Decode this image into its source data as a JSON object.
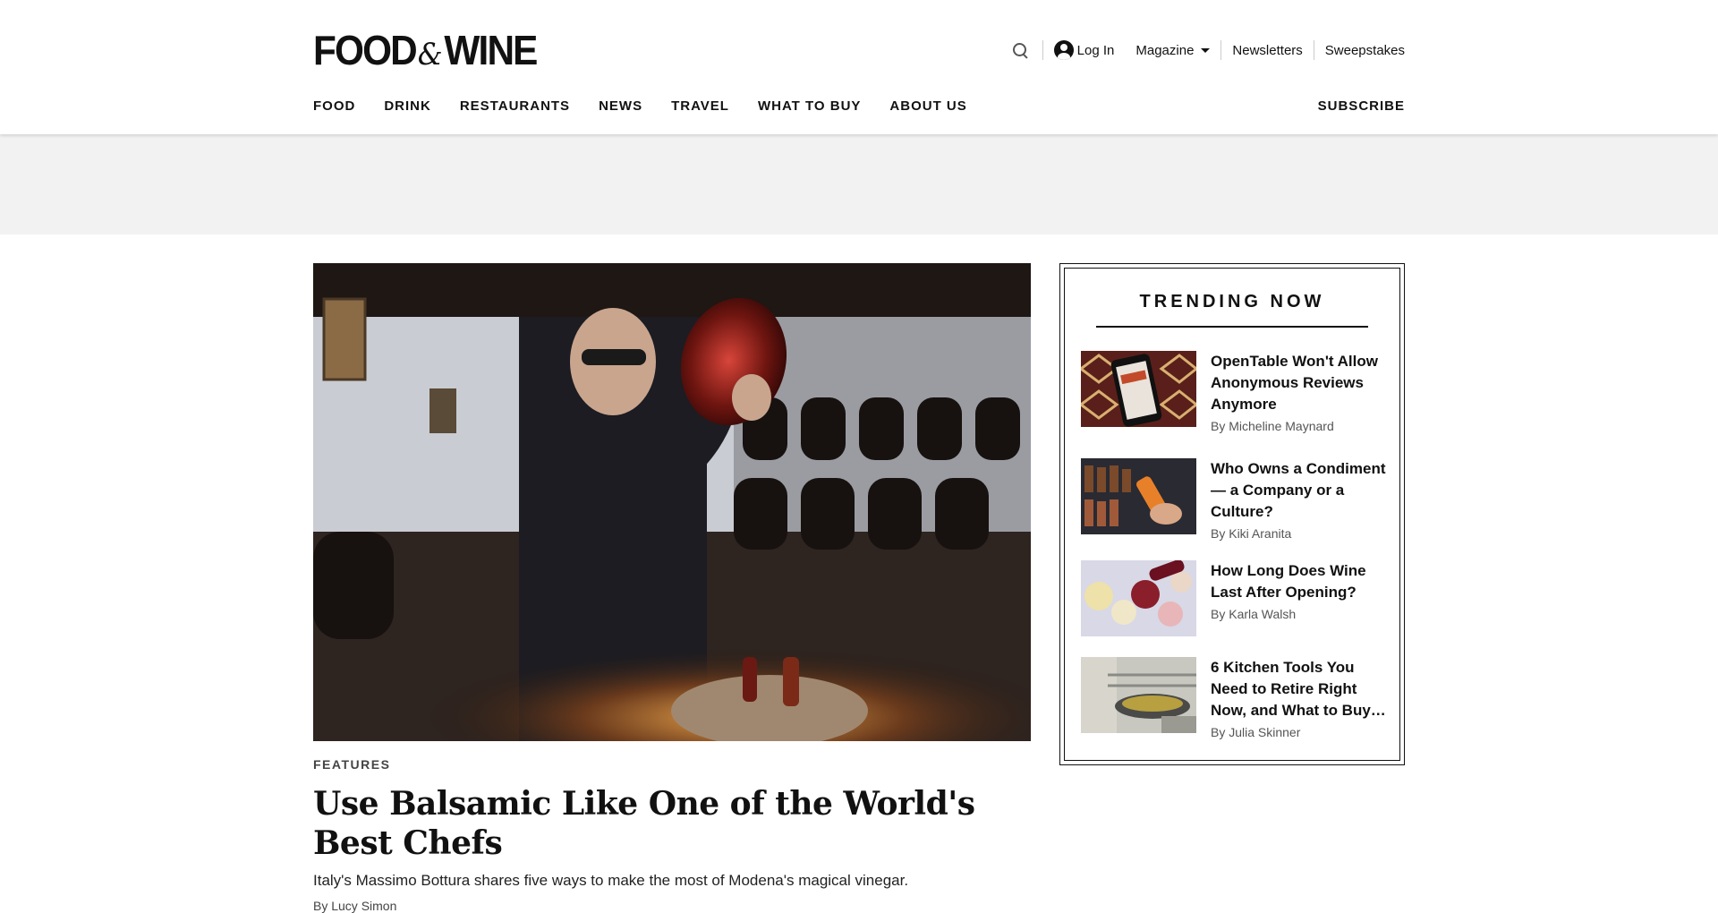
{
  "brand": {
    "logo_left": "FOOD",
    "logo_amp": "&",
    "logo_right": "WINE"
  },
  "utility": {
    "login": "Log In",
    "magazine": "Magazine",
    "newsletters": "Newsletters",
    "sweepstakes": "Sweepstakes"
  },
  "nav": {
    "items": [
      "FOOD",
      "DRINK",
      "RESTAURANTS",
      "NEWS",
      "TRAVEL",
      "WHAT TO BUY",
      "ABOUT US"
    ],
    "subscribe": "SUBSCRIBE"
  },
  "hero": {
    "kicker": "FEATURES",
    "headline": "Use Balsamic Like One of the World's Best Chefs",
    "dek": "Italy's Massimo Bottura shares five ways to make the most of Modena's magical vinegar.",
    "byline": "By Lucy Simon"
  },
  "trending": {
    "title": "TRENDING NOW",
    "items": [
      {
        "headline": "OpenTable Won't Allow Anonymous Reviews Anymore",
        "byline": "By Micheline Maynard"
      },
      {
        "headline": "Who Owns a Condiment — a Company or a Culture?",
        "byline": "By Kiki Aranita"
      },
      {
        "headline": "How Long Does Wine Last After Opening?",
        "byline": "By Karla Walsh"
      },
      {
        "headline": "6 Kitchen Tools You Need to Retire Right Now, and What to Buy…",
        "byline": "By Julia Skinner"
      }
    ]
  }
}
